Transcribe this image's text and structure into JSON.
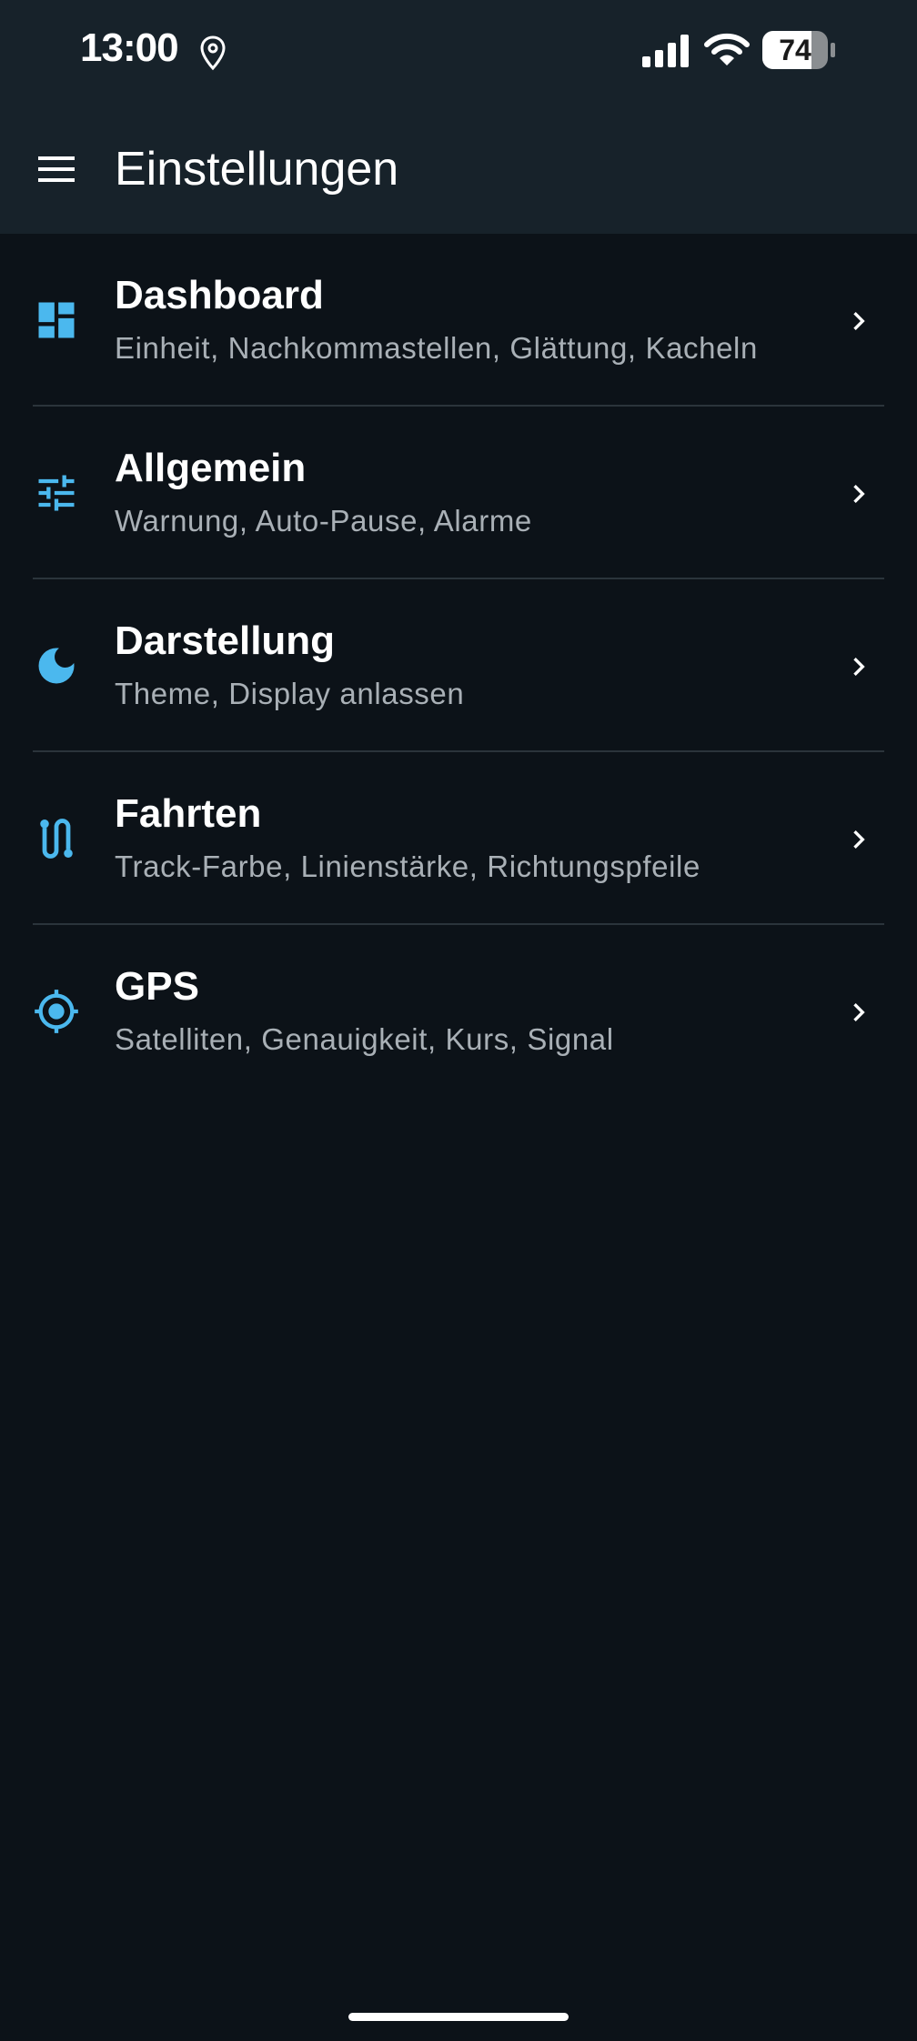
{
  "status_bar": {
    "time": "13:00",
    "battery": "74",
    "location_icon": "location-pin-icon",
    "signal_icon": "cellular-signal-icon",
    "wifi_icon": "wifi-icon",
    "battery_icon": "battery-icon"
  },
  "app_bar": {
    "title": "Einstellungen",
    "menu_icon": "menu-icon"
  },
  "colors": {
    "background": "#0c1218",
    "app_bar": "#17222a",
    "accent": "#4bb8ee",
    "subtitle": "#a9b0b6",
    "divider": "#2b343b"
  },
  "settings": [
    {
      "title": "Dashboard",
      "subtitle": "Einheit, Nachkommastellen, Glättung, Kacheln",
      "icon": "dashboard-icon"
    },
    {
      "title": "Allgemein",
      "subtitle": "Warnung, Auto-Pause, Alarme",
      "icon": "tune-sliders-icon"
    },
    {
      "title": "Darstellung",
      "subtitle": "Theme, Display anlassen",
      "icon": "moon-icon"
    },
    {
      "title": "Fahrten",
      "subtitle": "Track-Farbe, Linienstärke, Richtungspfeile",
      "icon": "route-icon"
    },
    {
      "title": "GPS",
      "subtitle": "Satelliten, Genauigkeit, Kurs, Signal",
      "icon": "gps-fixed-icon"
    }
  ]
}
